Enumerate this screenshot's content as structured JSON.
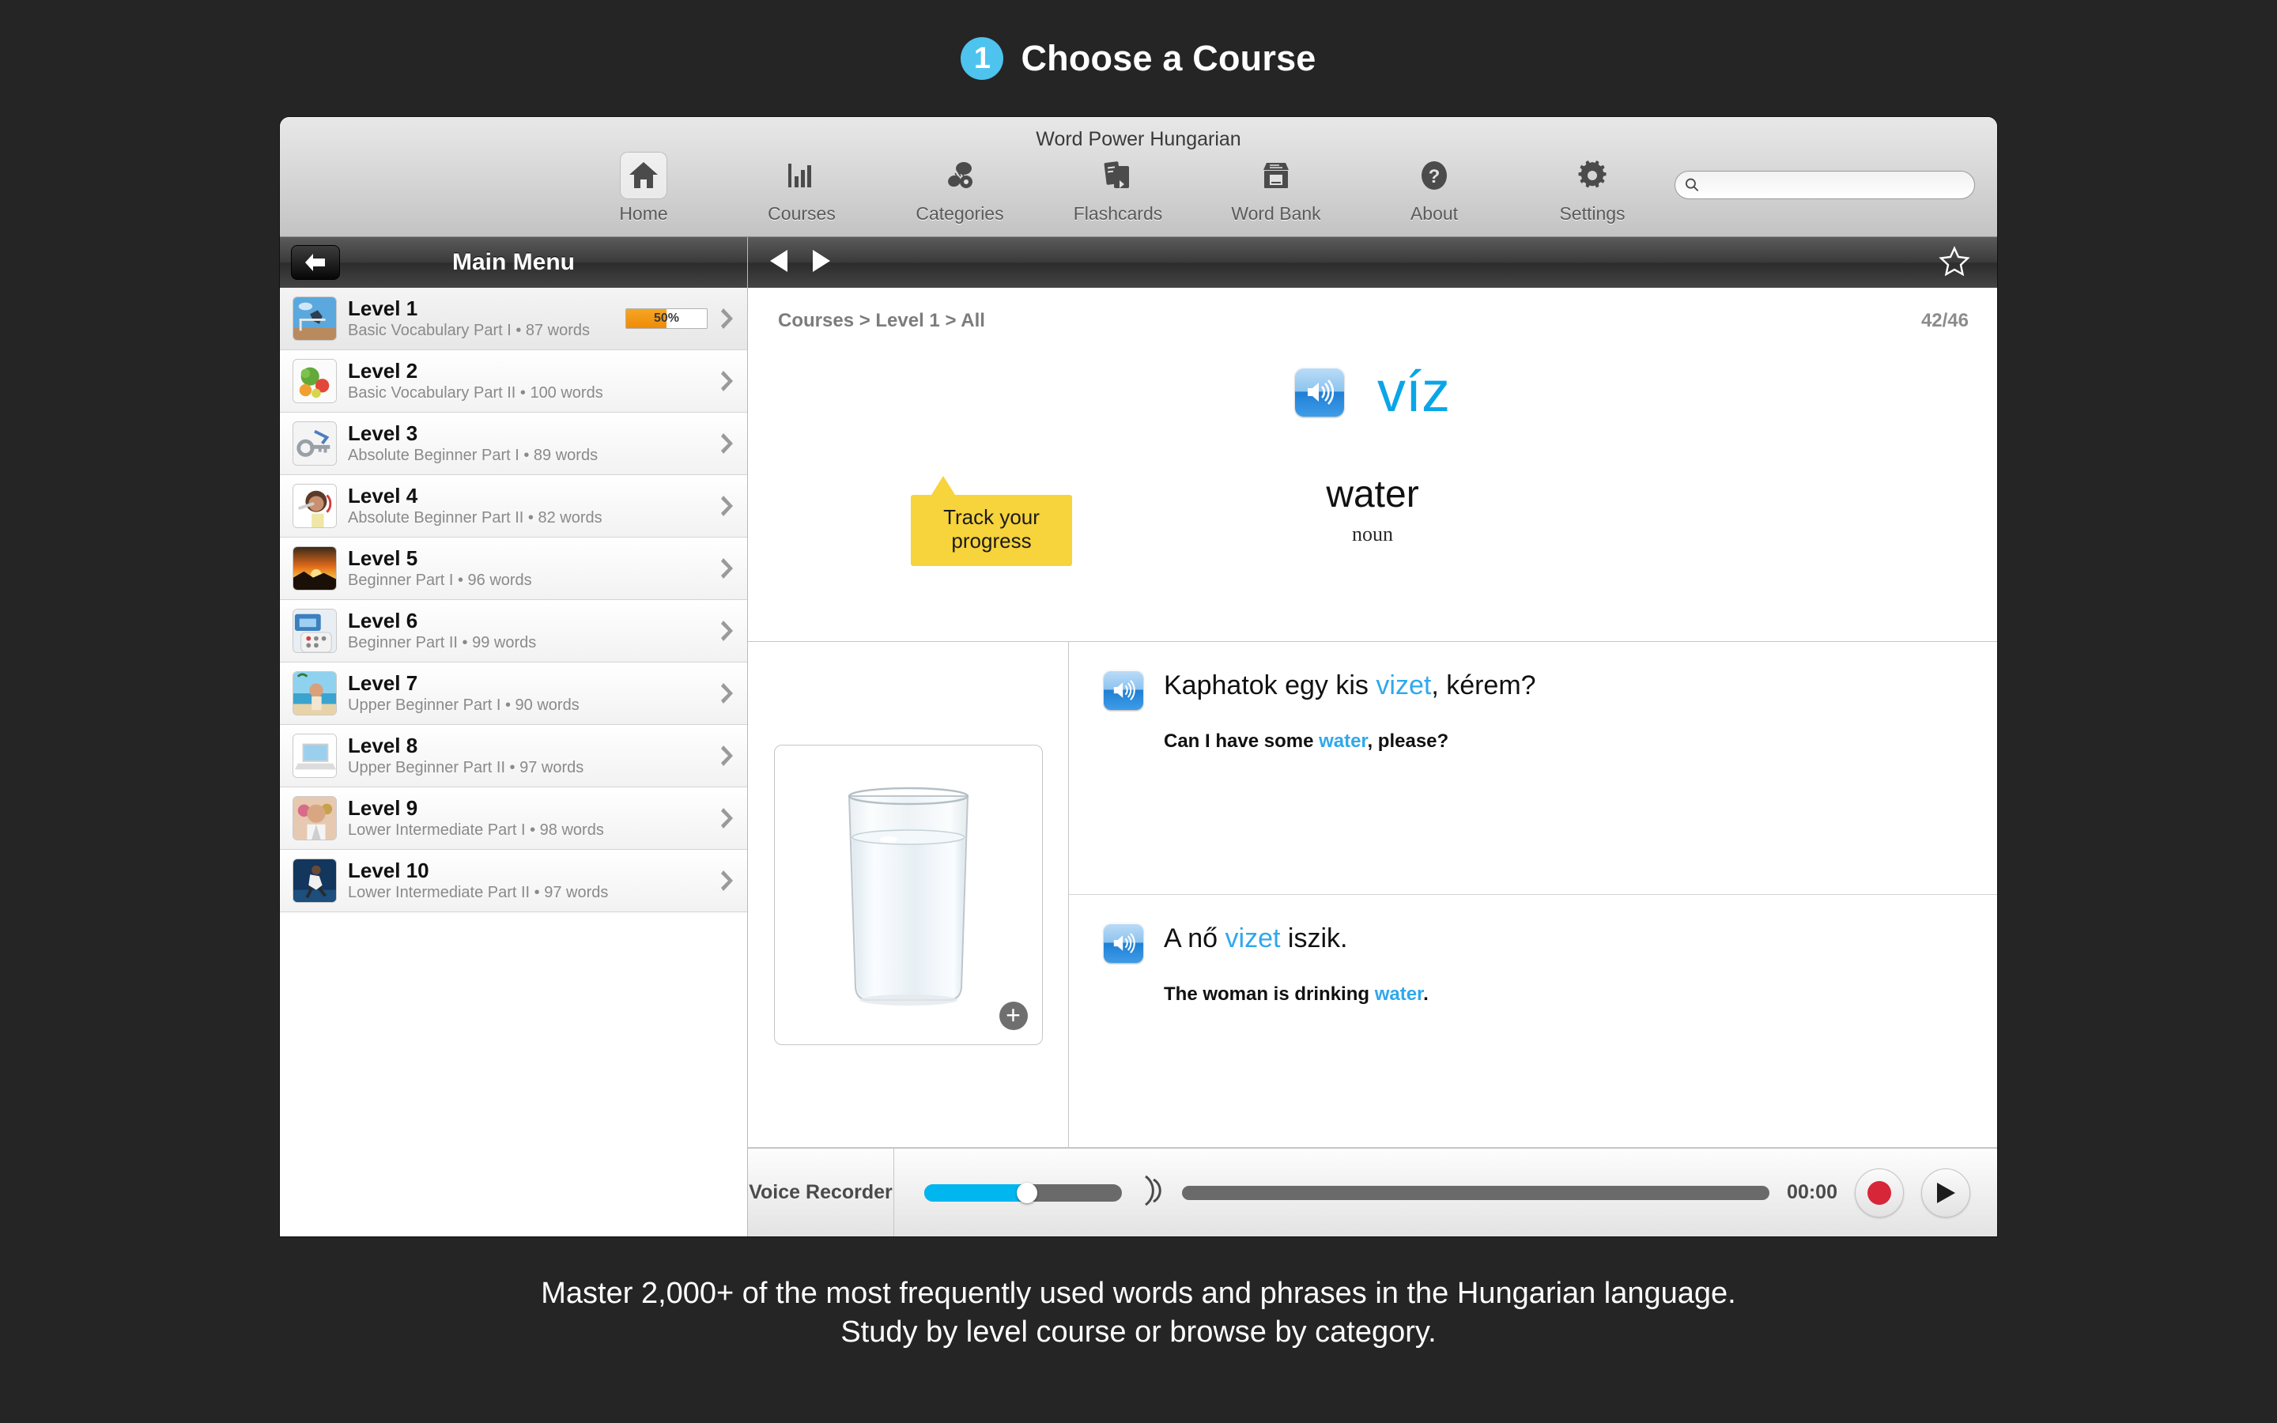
{
  "promo": {
    "step_number": "1",
    "title": "Choose a Course",
    "badge_color": "#4ec3ee",
    "caption_line1": "Master 2,000+ of the most frequently used words and phrases in the Hungarian language.",
    "caption_line2": "Study by level course or browse by category."
  },
  "window": {
    "title": "Word Power Hungarian"
  },
  "toolbar": {
    "items": [
      {
        "label": "Home",
        "icon": "home-icon"
      },
      {
        "label": "Courses",
        "icon": "bar-chart-icon"
      },
      {
        "label": "Categories",
        "icon": "categories-icon"
      },
      {
        "label": "Flashcards",
        "icon": "flashcards-icon"
      },
      {
        "label": "Word Bank",
        "icon": "word-bank-icon"
      },
      {
        "label": "About",
        "icon": "question-mark-icon"
      },
      {
        "label": "Settings",
        "icon": "gear-icon"
      }
    ],
    "search": {
      "value": "",
      "placeholder": ""
    }
  },
  "sidebar": {
    "title": "Main Menu",
    "back_label": "Back",
    "levels": [
      {
        "name": "Level 1",
        "subtitle": "Basic Vocabulary Part I • 87 words",
        "progress": 50,
        "progress_label": "50%",
        "thumb": "hurdle-runner-thumb"
      },
      {
        "name": "Level 2",
        "subtitle": "Basic Vocabulary Part II • 100 words",
        "progress": null,
        "progress_label": "",
        "thumb": "vegetables-thumb"
      },
      {
        "name": "Level 3",
        "subtitle": "Absolute Beginner Part I • 89 words",
        "progress": null,
        "progress_label": "",
        "thumb": "keys-thumb"
      },
      {
        "name": "Level 4",
        "subtitle": "Absolute Beginner Part II • 82 words",
        "progress": null,
        "progress_label": "",
        "thumb": "toothbrush-woman-thumb"
      },
      {
        "name": "Level 5",
        "subtitle": "Beginner Part I • 96 words",
        "progress": null,
        "progress_label": "",
        "thumb": "sunset-thumb"
      },
      {
        "name": "Level 6",
        "subtitle": "Beginner Part II • 99 words",
        "progress": null,
        "progress_label": "",
        "thumb": "remote-control-thumb"
      },
      {
        "name": "Level 7",
        "subtitle": "Upper Beginner Part I • 90 words",
        "progress": null,
        "progress_label": "",
        "thumb": "beach-thumb"
      },
      {
        "name": "Level 8",
        "subtitle": "Upper Beginner Part II • 97 words",
        "progress": null,
        "progress_label": "",
        "thumb": "laptop-thumb"
      },
      {
        "name": "Level 9",
        "subtitle": "Lower Intermediate Part I • 98 words",
        "progress": null,
        "progress_label": "",
        "thumb": "man-party-thumb"
      },
      {
        "name": "Level 10",
        "subtitle": "Lower Intermediate Part II • 97 words",
        "progress": null,
        "progress_label": "",
        "thumb": "runner-thumb"
      }
    ]
  },
  "callout": {
    "line1": "Track your",
    "line2": "progress",
    "background": "#f7d33c"
  },
  "main": {
    "breadcrumb": "Courses > Level 1 > All",
    "counter": "42/46",
    "word": {
      "target": "víz",
      "target_color": "#0aa5e8",
      "translation": "water",
      "part_of_speech": "noun"
    },
    "image_caption": "glass-of-water-photo",
    "sentences": [
      {
        "target_pre": "Kaphatok egy kis ",
        "target_hl": "vizet",
        "target_post": ", kérem?",
        "en_pre": "Can I have some ",
        "en_hl": "water",
        "en_post": ", please?"
      },
      {
        "target_pre": "A nő ",
        "target_hl": "vizet",
        "target_post": " iszik.",
        "en_pre": "The woman is drinking ",
        "en_hl": "water",
        "en_post": "."
      }
    ]
  },
  "recorder": {
    "label": "Voice Recorder",
    "volume_percent": 52,
    "time": "00:00",
    "record_label": "Record",
    "play_label": "Play",
    "accent_color": "#00b6ef",
    "record_color": "#d72638"
  }
}
